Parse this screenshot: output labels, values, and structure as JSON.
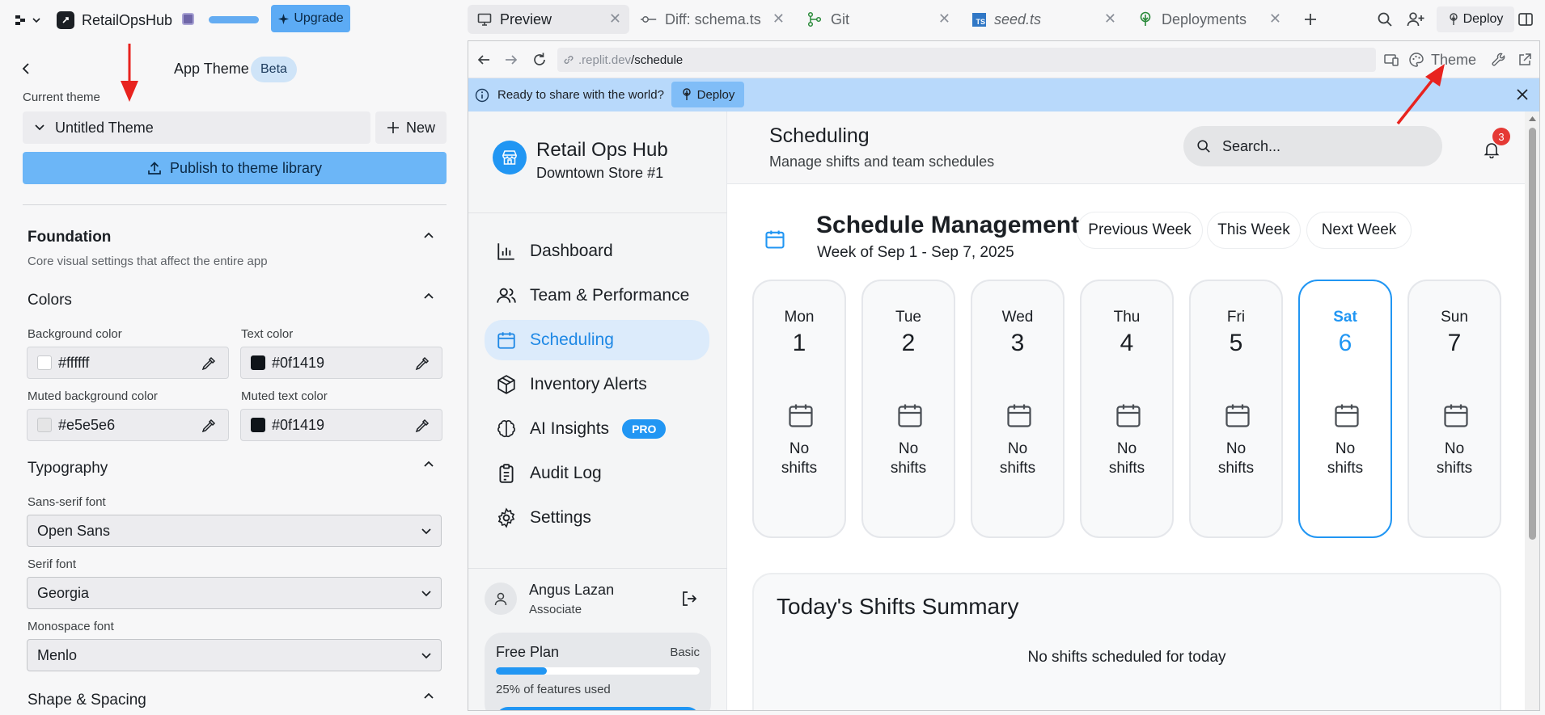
{
  "topbar": {
    "workspace_name": "RetailOpsHub",
    "upgrade_label": "Upgrade",
    "tabs": [
      {
        "label": "Preview",
        "icon": "monitor-icon",
        "active": true
      },
      {
        "label": "Diff: schema.ts",
        "icon": "diff-icon",
        "active": false
      },
      {
        "label": "Git",
        "icon": "git-icon",
        "active": false
      },
      {
        "label": "seed.ts",
        "icon": "typescript-file-icon",
        "active": false
      },
      {
        "label": "Deployments",
        "icon": "deployments-icon",
        "active": false
      }
    ],
    "deploy_label": "Deploy"
  },
  "theme_panel": {
    "title": "App Theme",
    "beta_badge": "Beta",
    "current_theme_label": "Current theme",
    "current_theme_value": "Untitled Theme",
    "new_label": "New",
    "publish_label": "Publish to theme library",
    "foundation": {
      "title": "Foundation",
      "description": "Core visual settings that affect the entire app"
    },
    "colors": {
      "title": "Colors",
      "background_label": "Background color",
      "background_value": "#ffffff",
      "text_label": "Text color",
      "text_value": "#0f1419",
      "muted_bg_label": "Muted background color",
      "muted_bg_value": "#e5e5e6",
      "muted_text_label": "Muted text color",
      "muted_text_value": "#0f1419"
    },
    "typography": {
      "title": "Typography",
      "sans_label": "Sans-serif font",
      "sans_value": "Open Sans",
      "serif_label": "Serif font",
      "serif_value": "Georgia",
      "mono_label": "Monospace font",
      "mono_value": "Menlo"
    },
    "shape_spacing": {
      "title": "Shape & Spacing"
    }
  },
  "browser": {
    "url_host": ".replit.dev",
    "url_path": "/schedule",
    "theme_label": "Theme",
    "banner_text": "Ready to share with the world?",
    "banner_deploy_label": "Deploy"
  },
  "app": {
    "brand_name": "Retail Ops Hub",
    "store_name": "Downtown Store #1",
    "nav": [
      {
        "label": "Dashboard",
        "icon": "bar-chart-icon"
      },
      {
        "label": "Team & Performance",
        "icon": "users-icon"
      },
      {
        "label": "Scheduling",
        "icon": "calendar-icon",
        "active": true
      },
      {
        "label": "Inventory Alerts",
        "icon": "package-icon"
      },
      {
        "label": "AI Insights",
        "icon": "brain-icon",
        "badge": "PRO"
      },
      {
        "label": "Audit Log",
        "icon": "clipboard-icon"
      },
      {
        "label": "Settings",
        "icon": "gear-icon"
      }
    ],
    "user": {
      "name": "Angus Lazan",
      "role": "Associate"
    },
    "plan": {
      "name": "Free Plan",
      "tier": "Basic",
      "usage_text": "25% of features used",
      "usage_fraction": 0.25
    },
    "header": {
      "title": "Scheduling",
      "subtitle": "Manage shifts and team schedules",
      "search_placeholder": "Search...",
      "notification_count": "3"
    },
    "schedule": {
      "title": "Schedule Management",
      "week_text": "Week of Sep 1 - Sep 7, 2025",
      "prev_label": "Previous Week",
      "this_label": "This Week",
      "next_label": "Next Week",
      "days": [
        {
          "name": "Mon",
          "num": "1",
          "empty_line1": "No",
          "empty_line2": "shifts"
        },
        {
          "name": "Tue",
          "num": "2",
          "empty_line1": "No",
          "empty_line2": "shifts"
        },
        {
          "name": "Wed",
          "num": "3",
          "empty_line1": "No",
          "empty_line2": "shifts"
        },
        {
          "name": "Thu",
          "num": "4",
          "empty_line1": "No",
          "empty_line2": "shifts"
        },
        {
          "name": "Fri",
          "num": "5",
          "empty_line1": "No",
          "empty_line2": "shifts"
        },
        {
          "name": "Sat",
          "num": "6",
          "empty_line1": "No",
          "empty_line2": "shifts",
          "selected": true
        },
        {
          "name": "Sun",
          "num": "7",
          "empty_line1": "No",
          "empty_line2": "shifts"
        }
      ],
      "summary_title": "Today's Shifts Summary",
      "summary_empty": "No shifts scheduled for today"
    }
  },
  "colors": {
    "accent": "#2196f3",
    "upgrade_bg": "#5cabf5",
    "publish_bg": "#6cb6f7",
    "banner_bg": "#b8d9fb",
    "annotation_red": "#e8231f"
  }
}
